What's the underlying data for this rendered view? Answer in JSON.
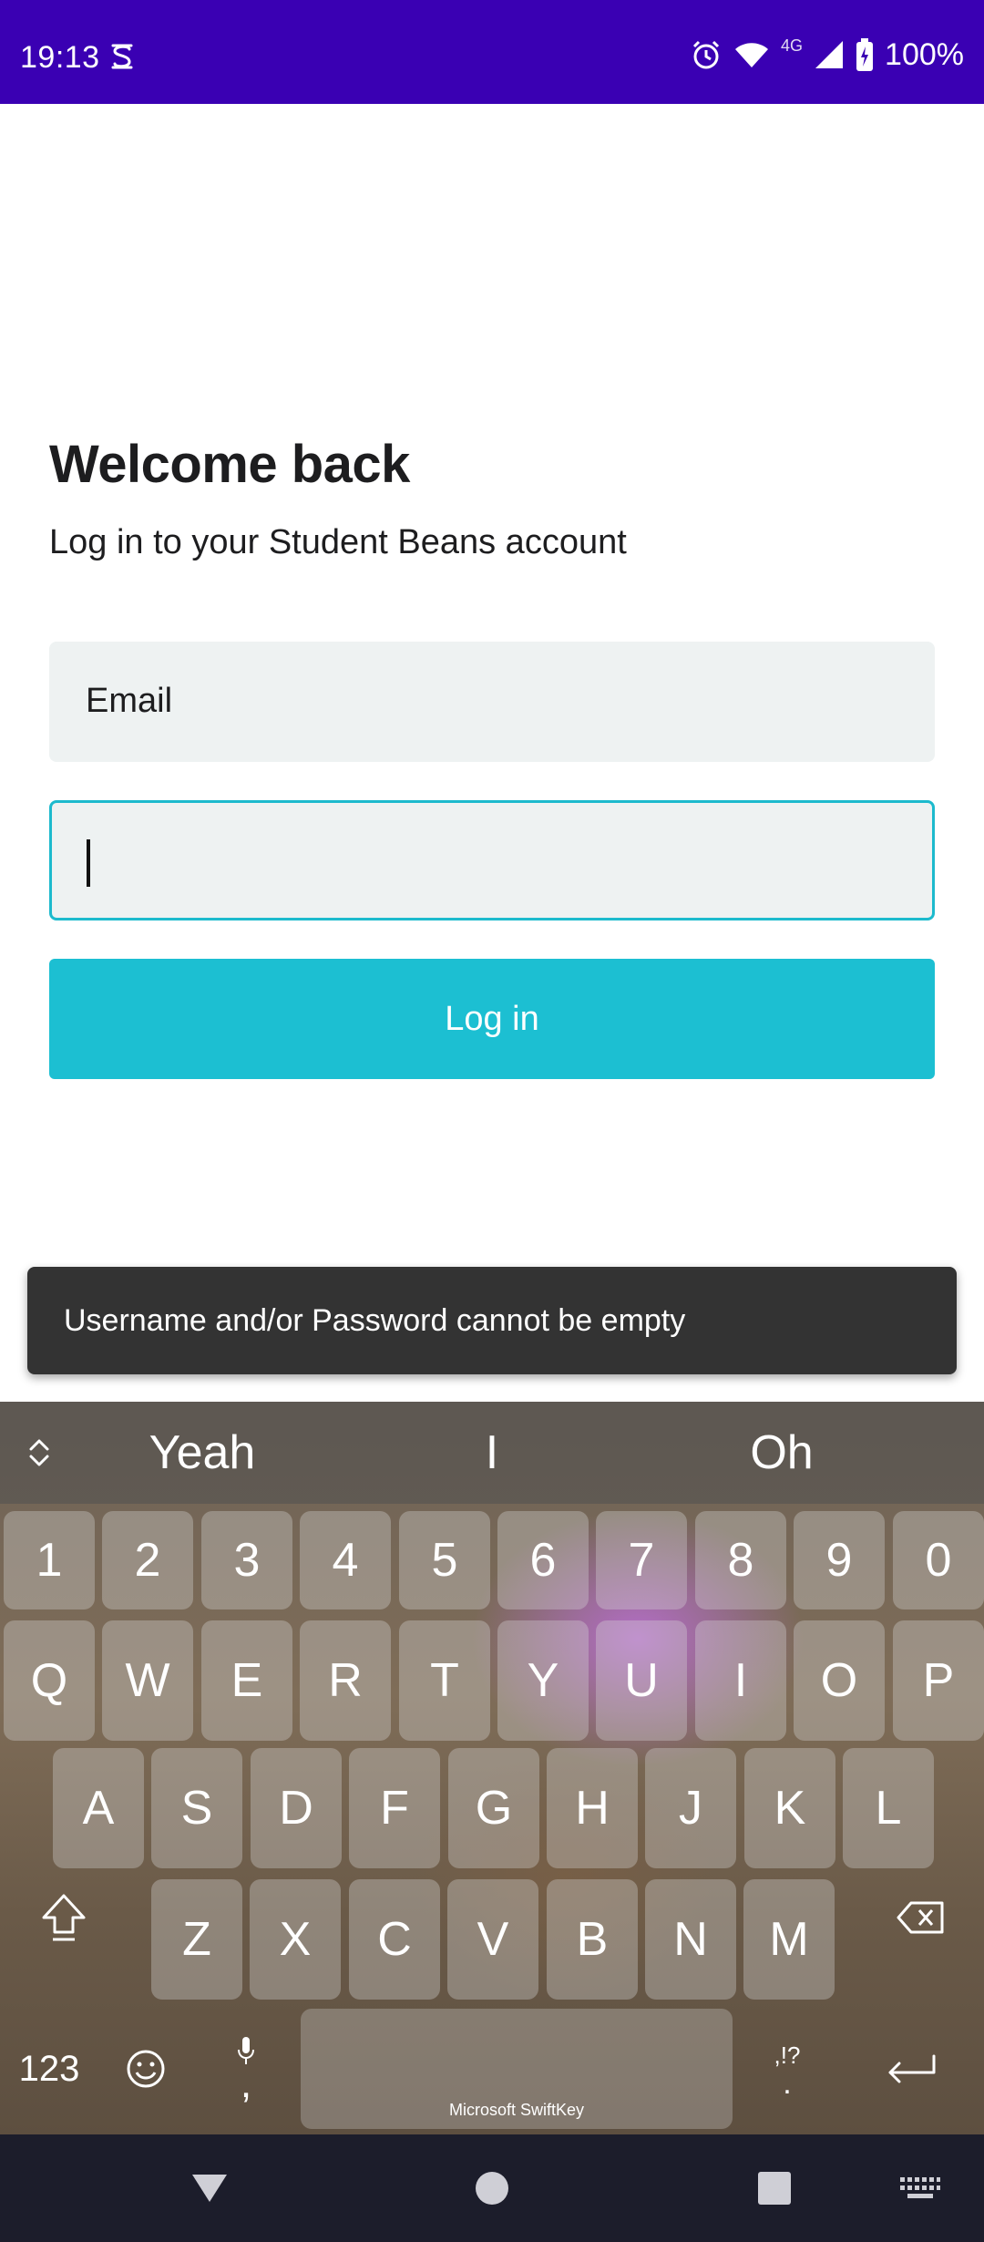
{
  "status_bar": {
    "time": "19:13",
    "network": "4G",
    "battery": "100%",
    "icons": [
      "s-icon",
      "alarm-icon",
      "wifi-icon",
      "signal-icon",
      "battery-icon"
    ]
  },
  "login": {
    "title": "Welcome back",
    "subtitle": "Log in to your Student Beans account",
    "email_label": "Email",
    "password_value": "",
    "login_button": "Log in",
    "accent_color": "#1cbfd2"
  },
  "snackbar": {
    "message": "Username and/or Password cannot be empty"
  },
  "keyboard": {
    "suggestions": [
      "Yeah",
      "I",
      "Oh"
    ],
    "number_row": [
      "1",
      "2",
      "3",
      "4",
      "5",
      "6",
      "7",
      "8",
      "9",
      "0"
    ],
    "row1": [
      "Q",
      "W",
      "E",
      "R",
      "T",
      "Y",
      "U",
      "I",
      "O",
      "P"
    ],
    "row2": [
      "A",
      "S",
      "D",
      "F",
      "G",
      "H",
      "J",
      "K",
      "L"
    ],
    "row3": [
      "Z",
      "X",
      "C",
      "V",
      "B",
      "N",
      "M"
    ],
    "numbers_key": "123",
    "comma": ",",
    "punct_top": ",!?",
    "punct_bottom": ".",
    "space_brand": "Microsoft SwiftKey"
  },
  "nav_bar": {
    "icons": [
      "back-icon",
      "home-icon",
      "recents-icon",
      "keyboard-switch-icon"
    ]
  }
}
